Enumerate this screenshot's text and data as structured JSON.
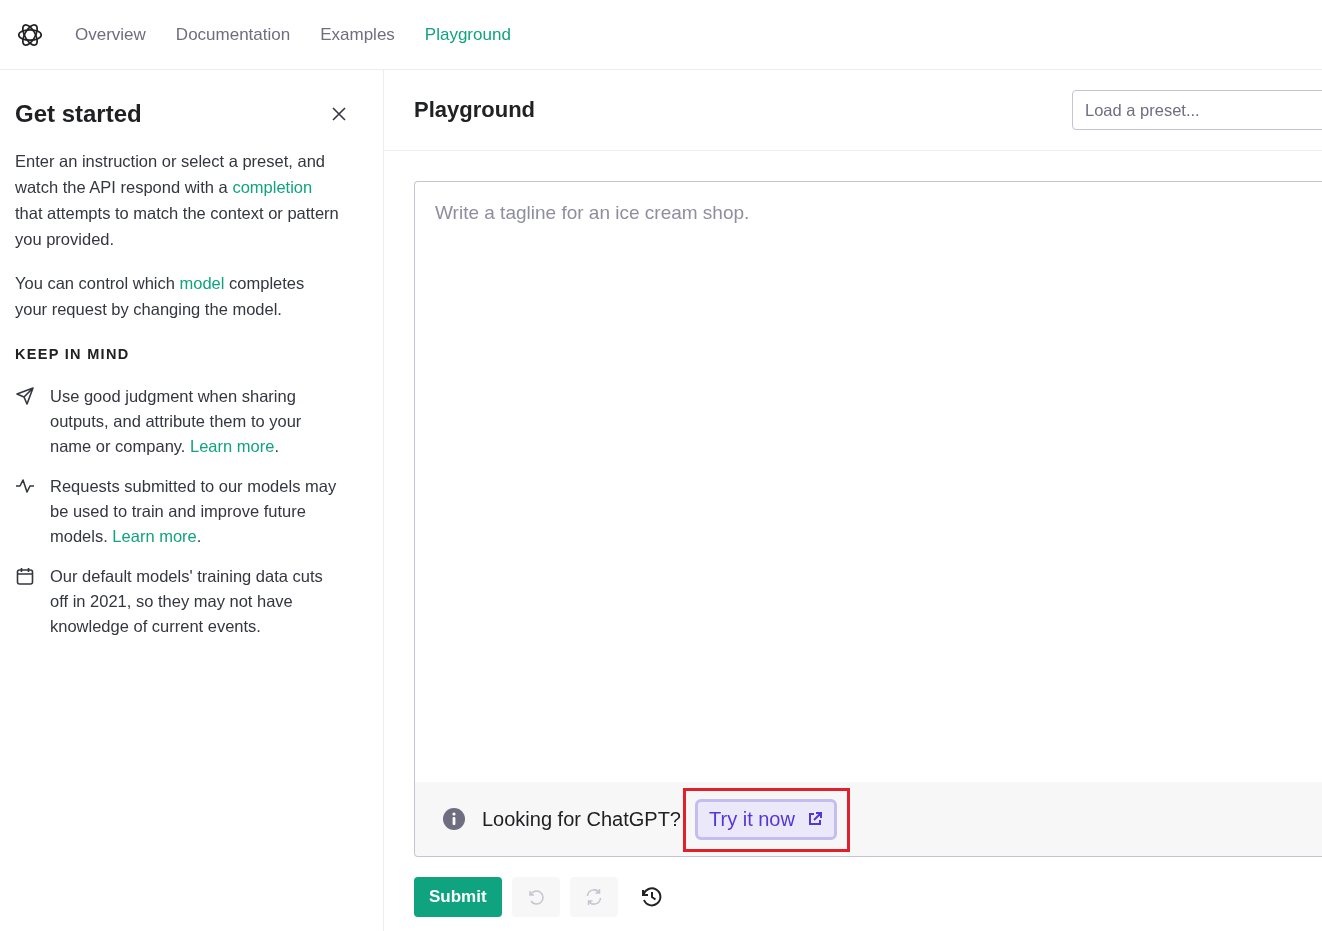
{
  "nav": {
    "items": [
      {
        "label": "Overview",
        "selected": false
      },
      {
        "label": "Documentation",
        "selected": false
      },
      {
        "label": "Examples",
        "selected": false
      },
      {
        "label": "Playground",
        "selected": true
      }
    ]
  },
  "sidebar": {
    "title": "Get started",
    "paragraphs": [
      {
        "before": "Enter an instruction or select a preset, and watch the API respond with a ",
        "link": "completion",
        "after": " that attempts to match the context or pattern you provided."
      },
      {
        "before": "You can control which ",
        "link": "model",
        "after": " completes your request by changing the model."
      }
    ],
    "section_heading": "KEEP IN MIND",
    "notes": [
      {
        "kind": "send",
        "text": "Use good judgment when sharing outputs, and attribute them to your name or company. ",
        "link": "Learn more",
        "after": "."
      },
      {
        "kind": "pulse",
        "text": "Requests submitted to our models may be used to train and improve future models. ",
        "link": "Learn more",
        "after": "."
      },
      {
        "kind": "calendar",
        "text": "Our default models' training data cuts off in 2021, so they may not have knowledge of current events."
      }
    ]
  },
  "main": {
    "title": "Playground",
    "preset": {
      "placeholder": "Load a preset..."
    },
    "prompt": {
      "placeholder": "Write a tagline for an ice cream shop."
    },
    "banner": {
      "text": "Looking for ChatGPT?",
      "button": "Try it now",
      "highlighted": true
    },
    "submit": "Submit",
    "tools": [
      {
        "kind": "undo",
        "disabled": true
      },
      {
        "kind": "regenerate",
        "disabled": true
      },
      {
        "kind": "history",
        "disabled": false
      }
    ]
  }
}
